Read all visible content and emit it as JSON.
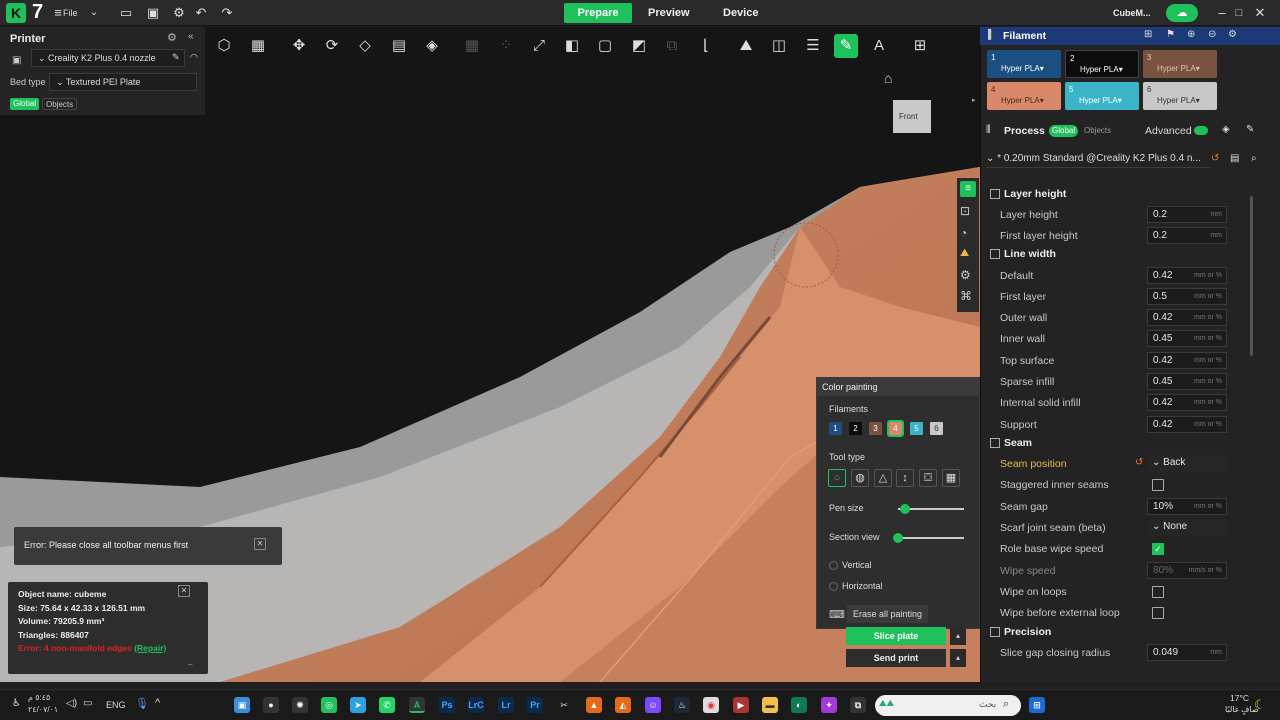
{
  "app": {
    "file_menu": "File",
    "window_title": "CubeM..."
  },
  "tabs": [
    "Prepare",
    "Preview",
    "Device"
  ],
  "printer": {
    "title": "Printer",
    "name": "Creality K2 Plus 0.4 nozzle",
    "bed_label": "Bed type",
    "bed_value": "Textured PEI Plate",
    "global": "Global",
    "objects": "Objects"
  },
  "view": {
    "front_label": "Front"
  },
  "filament": {
    "title": "Filament",
    "items": [
      {
        "num": "1",
        "name": "Hyper PLA",
        "color": "#1b4f82"
      },
      {
        "num": "2",
        "name": "Hyper PLA",
        "color": "#0b0b0b"
      },
      {
        "num": "3",
        "name": "Hyper PLA",
        "color": "#7a5340"
      },
      {
        "num": "4",
        "name": "Hyper PLA",
        "color": "#d9896a"
      },
      {
        "num": "5",
        "name": "Hyper PLA",
        "color": "#3bb4c8"
      },
      {
        "num": "6",
        "name": "Hyper PLA",
        "color": "#c8c8c8"
      }
    ]
  },
  "process": {
    "title": "Process",
    "global": "Global",
    "objects": "Objects",
    "advanced": "Advanced",
    "preset": "* 0.20mm Standard @Creality K2 Plus 0.4 n..."
  },
  "settings": {
    "layer_height_section": "Layer height",
    "layer_height": {
      "label": "Layer height",
      "value": "0.2",
      "unit": "mm"
    },
    "first_layer_height": {
      "label": "First layer height",
      "value": "0.2",
      "unit": "mm"
    },
    "line_width_section": "Line width",
    "default_width": {
      "label": "Default",
      "value": "0.42",
      "unit": "mm or %"
    },
    "first_layer_width": {
      "label": "First layer",
      "value": "0.5",
      "unit": "mm or %"
    },
    "outer_wall": {
      "label": "Outer wall",
      "value": "0.42",
      "unit": "mm or %"
    },
    "inner_wall": {
      "label": "Inner wall",
      "value": "0.45",
      "unit": "mm or %"
    },
    "top_surface": {
      "label": "Top surface",
      "value": "0.42",
      "unit": "mm or %"
    },
    "sparse_infill": {
      "label": "Sparse infill",
      "value": "0.45",
      "unit": "mm or %"
    },
    "internal_solid_infill": {
      "label": "Internal solid infill",
      "value": "0.42",
      "unit": "mm or %"
    },
    "support": {
      "label": "Support",
      "value": "0.42",
      "unit": "mm or %"
    },
    "seam_section": "Seam",
    "seam_position": {
      "label": "Seam position",
      "value": "Back"
    },
    "staggered_inner_seams": {
      "label": "Staggered inner seams"
    },
    "seam_gap": {
      "label": "Seam gap",
      "value": "10%",
      "unit": "mm or %"
    },
    "scarf_joint_seam": {
      "label": "Scarf joint seam (beta)",
      "value": "None"
    },
    "role_base_wipe_speed": {
      "label": "Role base wipe speed"
    },
    "wipe_speed": {
      "label": "Wipe speed",
      "value": "80%",
      "unit": "mm/s or %"
    },
    "wipe_on_loops": {
      "label": "Wipe on loops"
    },
    "wipe_before_external_loop": {
      "label": "Wipe before external loop"
    },
    "precision_section": "Precision",
    "slice_gap_closing_radius": {
      "label": "Slice gap closing radius",
      "value": "0.049",
      "unit": "mm"
    }
  },
  "color_painting": {
    "title": "Color painting",
    "filaments_label": "Filaments",
    "tool_type_label": "Tool type",
    "pen_size_label": "Pen size",
    "section_view_label": "Section view",
    "pen_size": 0.1,
    "section_view": 0.0,
    "vertical": "Vertical",
    "horizontal": "Horizontal",
    "erase_all": "Erase all painting",
    "filament_numbers": [
      "1",
      "2",
      "3",
      "4",
      "5",
      "6"
    ]
  },
  "actions": {
    "slice": "Slice plate",
    "send": "Send print"
  },
  "notice": {
    "error_toolbar": "Error: Please close all toolbar menus first"
  },
  "object_info": {
    "name": "Object name: cubeme",
    "size": "Size: 75.64 x 42.33 x 126.51 mm",
    "volume": "Volume: 79205.9 mm³",
    "triangles": "Triangles: 886407",
    "error": "Error: 4 non-manifold edges",
    "repair": "(Repair)"
  },
  "taskbar": {
    "lang": "ENG",
    "search": "بحث",
    "temp": "17°C",
    "weather": "صافٍ غالبًا",
    "time": "٥:٤٥ م",
    "date": "٢٤/٠٧/٠١"
  },
  "colors": {
    "accent": "#1ec15b",
    "seam_highlight": "#e8b84a",
    "error": "#e02020"
  }
}
